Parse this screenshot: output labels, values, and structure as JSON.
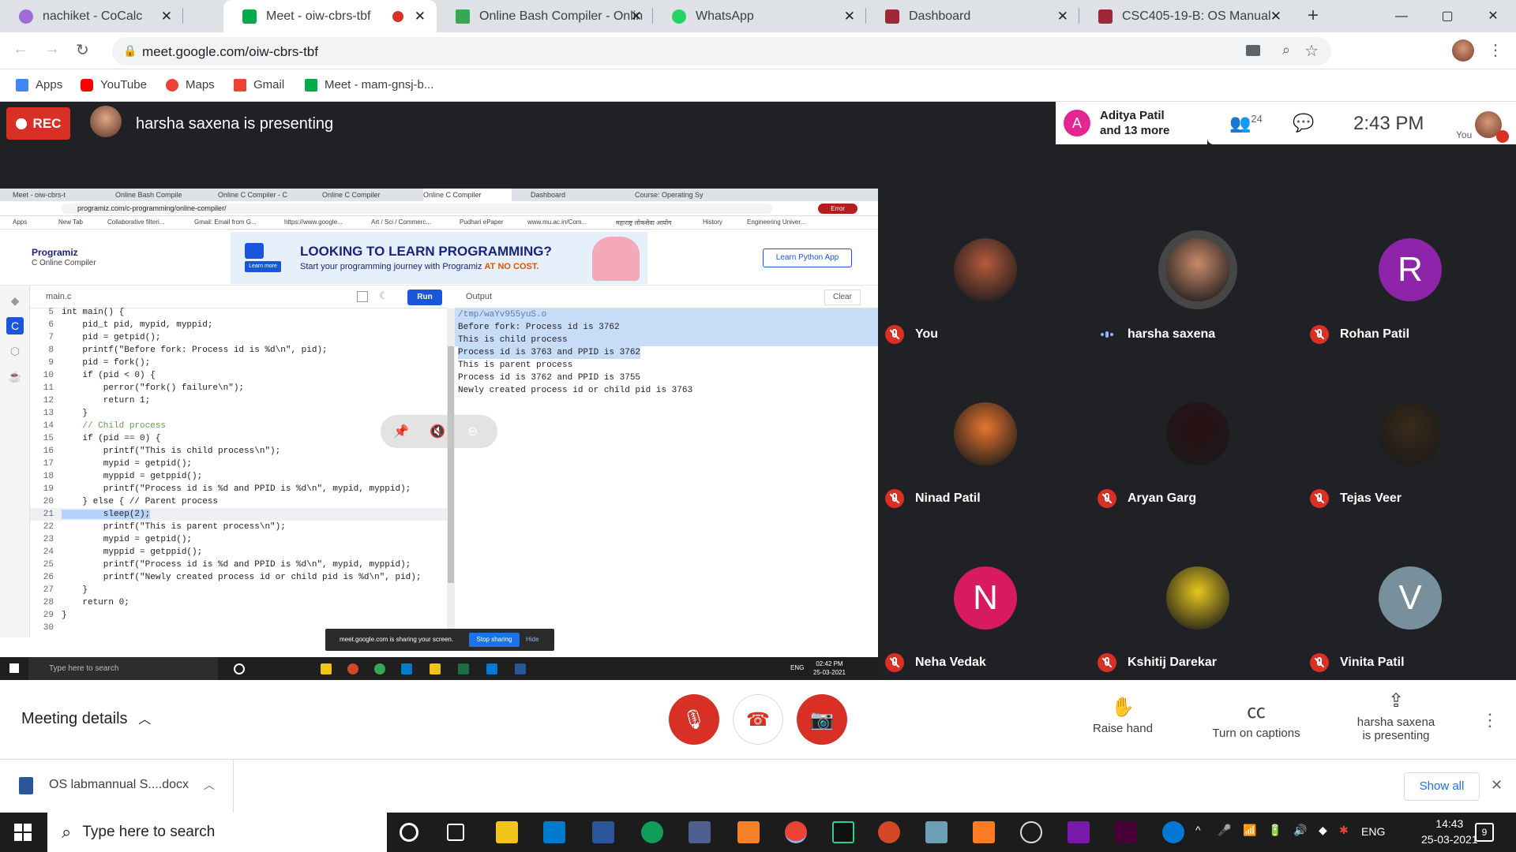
{
  "browser": {
    "tabs": [
      {
        "title": "nachiket - CoCalc",
        "color": "#9f6cd8"
      },
      {
        "title": "Meet - oiw-cbrs-tbf",
        "color": "#00ac47"
      },
      {
        "title": "Online Bash Compiler - Onlin",
        "color": "#34a853"
      },
      {
        "title": "WhatsApp",
        "color": "#25d366"
      },
      {
        "title": "Dashboard",
        "color": "#a0273a"
      },
      {
        "title": "CSC405-19-B: OS Manual",
        "color": "#a0273a"
      }
    ],
    "url": "meet.google.com/oiw-cbrs-tbf",
    "bookmarks": [
      {
        "label": "Apps",
        "color": "#4285f4"
      },
      {
        "label": "YouTube",
        "color": "#ff0000"
      },
      {
        "label": "Maps",
        "color": "#ea4335"
      },
      {
        "label": "Gmail",
        "color": "#ea4335"
      },
      {
        "label": "Meet - mam-gnsj-b...",
        "color": "#00ac47"
      }
    ]
  },
  "meet": {
    "rec_label": "REC",
    "presenting_text": "harsha saxena is presenting",
    "notification": {
      "avatar_letter": "A",
      "line1": "Aditya Patil",
      "line2": "and 13 more"
    },
    "people_count": "24",
    "time": "2:43 PM",
    "you_label": "You",
    "participants": [
      {
        "name": "You",
        "type": "photo",
        "color": "#b55a3c",
        "mic": "off"
      },
      {
        "name": "harsha saxena",
        "type": "photo",
        "color": "#c98a6a",
        "mic": "speaking"
      },
      {
        "name": "Rohan Patil",
        "type": "letter",
        "letter": "R",
        "color": "#8e24aa",
        "mic": "off"
      },
      {
        "name": "Ninad Patil",
        "type": "photo",
        "color": "#e8752f",
        "mic": "off"
      },
      {
        "name": "Aryan Garg",
        "type": "photo",
        "color": "#2a0f14",
        "mic": "off"
      },
      {
        "name": "Tejas Veer",
        "type": "photo",
        "color": "#3a2a1a",
        "mic": "off"
      },
      {
        "name": "Neha Vedak",
        "type": "letter",
        "letter": "N",
        "color": "#d81b60",
        "mic": "off"
      },
      {
        "name": "Kshitij Darekar",
        "type": "photo",
        "color": "#e7c81d",
        "mic": "off"
      },
      {
        "name": "Vinita Patil",
        "type": "letter",
        "letter": "V",
        "color": "#78909c",
        "mic": "off"
      }
    ],
    "meeting_details": "Meeting details",
    "raise_hand": "Raise hand",
    "captions": "Turn on captions",
    "presenting_line1": "harsha saxena",
    "presenting_line2": "is presenting"
  },
  "shared": {
    "tabs": [
      "Meet - oiw-cbrs-t",
      "Online Bash Compile",
      "Online C Compiler - C",
      "Online C Compiler",
      "Online C Compiler",
      "Dashboard",
      "Course: Operating Sy"
    ],
    "url": "programiz.com/c-programming/online-compiler/",
    "error": "Error",
    "bookmarks": [
      "Apps",
      "New Tab",
      "Collaborative filteri...",
      "Gmail: Email from G...",
      "https://www.google...",
      "Art / Sci / Commerc...",
      "Pudhari ePaper",
      "www.mu.ac.in/Com...",
      "महाराष्ट्र लोकसेवा आयोग",
      "History",
      "Engineering Univer..."
    ],
    "logo": "Programiz",
    "logo_sub": "C Online Compiler",
    "banner_title": "LOOKING TO LEARN PROGRAMMING?",
    "banner_sub": "Start your programming journey with Programiz",
    "banner_highlight": "AT NO COST.",
    "banner_button": "Learn more",
    "learn_app": "Learn Python App",
    "filename": "main.c",
    "run": "Run",
    "output_label": "Output",
    "clear": "Clear",
    "code": [
      {
        "n": "5",
        "t": "int main() {"
      },
      {
        "n": "6",
        "t": "    pid_t pid, mypid, myppid;"
      },
      {
        "n": "7",
        "t": "    pid = getpid();"
      },
      {
        "n": "8",
        "t": "    printf(\"Before fork: Process id is %d\\n\", pid);"
      },
      {
        "n": "9",
        "t": "    pid = fork();"
      },
      {
        "n": "10",
        "t": "    if (pid < 0) {"
      },
      {
        "n": "11",
        "t": "        perror(\"fork() failure\\n\");"
      },
      {
        "n": "12",
        "t": "        return 1;"
      },
      {
        "n": "13",
        "t": "    }"
      },
      {
        "n": "14",
        "t": "    // Child process"
      },
      {
        "n": "15",
        "t": "    if (pid == 0) {"
      },
      {
        "n": "16",
        "t": "        printf(\"This is child process\\n\");"
      },
      {
        "n": "17",
        "t": "        mypid = getpid();"
      },
      {
        "n": "18",
        "t": "        myppid = getppid();"
      },
      {
        "n": "19",
        "t": "        printf(\"Process id is %d and PPID is %d\\n\", mypid, myppid);"
      },
      {
        "n": "20",
        "t": "    } else { // Parent process"
      },
      {
        "n": "21",
        "t": "        sleep(2);"
      },
      {
        "n": "22",
        "t": "        printf(\"This is parent process\\n\");"
      },
      {
        "n": "23",
        "t": "        mypid = getpid();"
      },
      {
        "n": "24",
        "t": "        myppid = getppid();"
      },
      {
        "n": "25",
        "t": "        printf(\"Process id is %d and PPID is %d\\n\", mypid, myppid);"
      },
      {
        "n": "26",
        "t": "        printf(\"Newly created process id or child pid is %d\\n\", pid);"
      },
      {
        "n": "27",
        "t": "    }"
      },
      {
        "n": "28",
        "t": "    return 0;"
      },
      {
        "n": "29",
        "t": "}"
      },
      {
        "n": "30",
        "t": ""
      }
    ],
    "output": [
      "/tmp/waYv955yuS.o",
      "Before fork: Process id is 3762",
      "This is child process",
      "Process id is 3763 and PPID is 3762",
      "This is parent process",
      "Process id is 3762 and PPID is 3755",
      "Newly created process id or child pid is 3763"
    ],
    "sharing_text": "meet.google.com is sharing your screen.",
    "stop_sharing": "Stop sharing",
    "hide": "Hide",
    "taskbar_search": "Type here to search",
    "taskbar_lang": "ENG",
    "taskbar_time": "02:42 PM",
    "taskbar_date": "25-03-2021"
  },
  "downloads": {
    "file": "OS labmannual S....docx",
    "show_all": "Show all"
  },
  "taskbar": {
    "search": "Type here to search",
    "lang": "ENG",
    "time": "14:43",
    "date": "25-03-2021",
    "notifications": "9"
  }
}
